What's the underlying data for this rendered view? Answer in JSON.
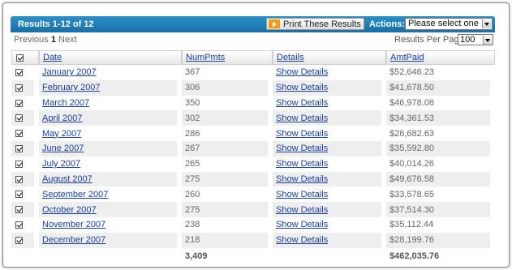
{
  "toolbar": {
    "results_title": "Results 1-12 of 12",
    "print_label": "Print These Results",
    "actions_label": "Actions:",
    "actions_selected": "Please select one"
  },
  "pager": {
    "previous": "Previous",
    "current": "1",
    "next": "Next",
    "per_page_label": "Results Per Page",
    "per_page_value": "100"
  },
  "table": {
    "headers": {
      "date": "Date",
      "num_pmts": "NumPmts",
      "details": "Details",
      "amt_paid": "AmtPaid"
    },
    "rows": [
      {
        "date": "January 2007",
        "num_pmts": "367",
        "details": "Show Details",
        "amt_paid": "$52,646.23"
      },
      {
        "date": "February 2007",
        "num_pmts": "306",
        "details": "Show Details",
        "amt_paid": "$41,678.50"
      },
      {
        "date": "March 2007",
        "num_pmts": "350",
        "details": "Show Details",
        "amt_paid": "$46,978.08"
      },
      {
        "date": "April 2007",
        "num_pmts": "302",
        "details": "Show Details",
        "amt_paid": "$34,361.53"
      },
      {
        "date": "May 2007",
        "num_pmts": "286",
        "details": "Show Details",
        "amt_paid": "$26,682.63"
      },
      {
        "date": "June 2007",
        "num_pmts": "267",
        "details": "Show Details",
        "amt_paid": "$35,592.80"
      },
      {
        "date": "July 2007",
        "num_pmts": "265",
        "details": "Show Details",
        "amt_paid": "$40,014.26"
      },
      {
        "date": "August 2007",
        "num_pmts": "275",
        "details": "Show Details",
        "amt_paid": "$49,676.58"
      },
      {
        "date": "September 2007",
        "num_pmts": "260",
        "details": "Show Details",
        "amt_paid": "$33,578.65"
      },
      {
        "date": "October 2007",
        "num_pmts": "275",
        "details": "Show Details",
        "amt_paid": "$37,514.30"
      },
      {
        "date": "November 2007",
        "num_pmts": "238",
        "details": "Show Details",
        "amt_paid": "$35,112.44"
      },
      {
        "date": "December 2007",
        "num_pmts": "218",
        "details": "Show Details",
        "amt_paid": "$28,199.76"
      }
    ],
    "totals": {
      "num_pmts": "3,409",
      "amt_paid": "$462,035.76"
    }
  },
  "icons": {
    "print": "play-icon",
    "checkbox": "checkbox-checked-icon",
    "dropdown": "chevron-down-icon"
  },
  "colors": {
    "header_bar": "#1a78b0",
    "print_icon": "#f39a1c",
    "link": "#1a3fa0",
    "row_alt": "#eeeeee"
  }
}
